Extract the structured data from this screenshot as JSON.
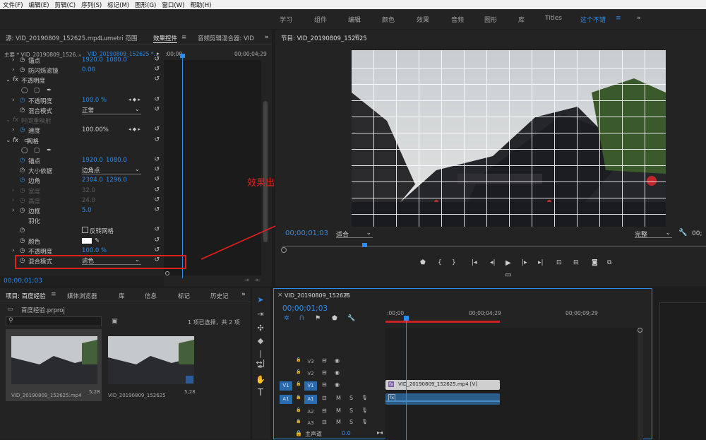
{
  "menu": [
    "文件(F)",
    "编辑(E)",
    "剪辑(C)",
    "序列(S)",
    "标记(M)",
    "图形(G)",
    "窗口(W)",
    "帮助(H)"
  ],
  "workspaces": [
    "学习",
    "组件",
    "编辑",
    "颜色",
    "效果",
    "音频",
    "图形",
    "库",
    "Titles",
    "这个不错"
  ],
  "workspace_more": "»",
  "source_panel": {
    "tabs": [
      "源: VID_20190809_152625.mp4",
      "Lumetri 范围",
      "效果控件",
      "音频剪辑混合器: VID"
    ],
    "more": "»",
    "master_label": "主要 * VID_20190809_1526...",
    "clip_label": "VID_20190809_152625 *...",
    "tc_start": ":00;00",
    "tc_end": "00;00;04;29",
    "rows": [
      {
        "label": "锚点",
        "v1": "1920.0",
        "v2": "1080.0"
      },
      {
        "label": "防闪烁滤镜",
        "v1": "0.00"
      },
      {
        "label": "不透明度"
      },
      {
        "label": "不透明度",
        "v1": "100.0 %"
      },
      {
        "label": "混合模式",
        "dd": "正常"
      },
      {
        "label": "时间重映射"
      },
      {
        "label": "速度",
        "v1": "100.00%"
      },
      {
        "label": "网格"
      },
      {
        "label": "锚点",
        "v1": "1920.0",
        "v2": "1080.0"
      },
      {
        "label": "大小依据",
        "dd": "边角点"
      },
      {
        "label": "边角",
        "v1": "2304.0",
        "v2": "1296.0"
      },
      {
        "label": "宽度",
        "v1": "32.0"
      },
      {
        "label": "高度",
        "v1": "24.0"
      },
      {
        "label": "边框",
        "v1": "5.0"
      },
      {
        "label": "羽化"
      },
      {
        "label": "反转网格"
      },
      {
        "label": "颜色"
      },
      {
        "label": "不透明度",
        "v1": "100.0 %"
      },
      {
        "label": "混合模式",
        "dd": "滤色"
      }
    ],
    "current_time": "00;00;01;03"
  },
  "annotation": {
    "text": "效果出现",
    "highlight_color": "#e0201b"
  },
  "program": {
    "title": "节目: VID_20190809_152625",
    "timecode": "00;00;01;03",
    "fit": "适合",
    "quality": "完整",
    "tc_right": "00;"
  },
  "project": {
    "tabs": [
      "项目: 百度经验",
      "媒体浏览器",
      "库",
      "信息",
      "标记",
      "历史记"
    ],
    "more": "»",
    "file": "百度经验.prproj",
    "selection": "1 项已选择，共 2 项",
    "items": [
      {
        "name": "VID_20190809_152625.mp4",
        "duration": "5;28"
      },
      {
        "name": "VID_20190809_152625",
        "duration": "5;28"
      }
    ]
  },
  "timeline": {
    "title": "VID_20190809_152625",
    "timecode": "00;00;01;03",
    "ruler": [
      ":00;00",
      "00;00;04;29",
      "00;00;09;29"
    ],
    "clip_label": "VID_20190809_152625.mp4 [V]",
    "fx_badge": "fx",
    "tracks": [
      {
        "name": "V3",
        "type": "video"
      },
      {
        "name": "V2",
        "type": "video"
      },
      {
        "name": "V1",
        "type": "video",
        "src": "V1"
      },
      {
        "name": "A1",
        "type": "audio",
        "src": "A1"
      },
      {
        "name": "A2",
        "type": "audio"
      },
      {
        "name": "A3",
        "type": "audio"
      }
    ],
    "master": "主声道",
    "master_val": "0.0",
    "m": "M",
    "s": "S"
  },
  "colors": {
    "accent": "#2d8ceb",
    "playhead": "#2d8ceb",
    "bg": "#232323"
  }
}
